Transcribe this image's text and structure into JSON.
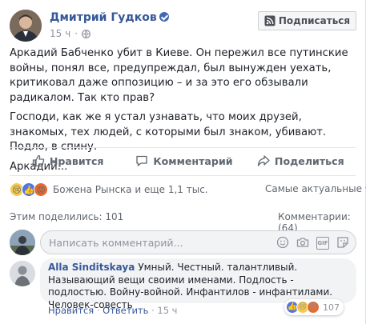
{
  "post": {
    "author": "Дмитрий Гудков",
    "time": "15 ч",
    "subscribe_label": "Подписаться",
    "paragraphs": [
      "Аркадий Бабченко убит в Киеве. Он пережил все путинские войны, понял все, предупреждал, был вынужден уехать, критиковал даже оппозицию – и за это его обзывали радикалом. Так кто прав?",
      "Господи, как же я устал узнавать, что моих друзей, знакомых, тех людей, с которыми был знаком, убивают. Подло, в спину.",
      "Аркадий..."
    ]
  },
  "actions": {
    "like": "Нравится",
    "comment": "Комментарий",
    "share": "Поделиться"
  },
  "reactions": {
    "icons": [
      "sad-icon",
      "like-icon",
      "angry-icon"
    ],
    "summary": "Божена Рынска и еще 1,1 тыс.",
    "sort_label": "Самые актуальные"
  },
  "stats": {
    "shares": "Этим поделились: 101",
    "comments": "Комментарии: (64)"
  },
  "comment_input": {
    "placeholder": "Написать комментарий...",
    "icons": [
      "emoji-icon",
      "camera-icon",
      "gif-icon",
      "sticker-icon"
    ]
  },
  "comment": {
    "author": "Alla Sinditskaya",
    "text": "Умный. Честный. талантливый. Называющий вещи своими именами. Подлость - подлостью. Войну-войной. Инфантилов - инфантилами. Человек-совесть",
    "like": "Нравится",
    "reply": "Ответить",
    "time": "15 ч",
    "sep": " · ",
    "reaction_count": "107"
  },
  "colors": {
    "link": "#365899",
    "accent": "#4267b2",
    "muted": "#90949c",
    "bubble": "#f2f3f5"
  }
}
